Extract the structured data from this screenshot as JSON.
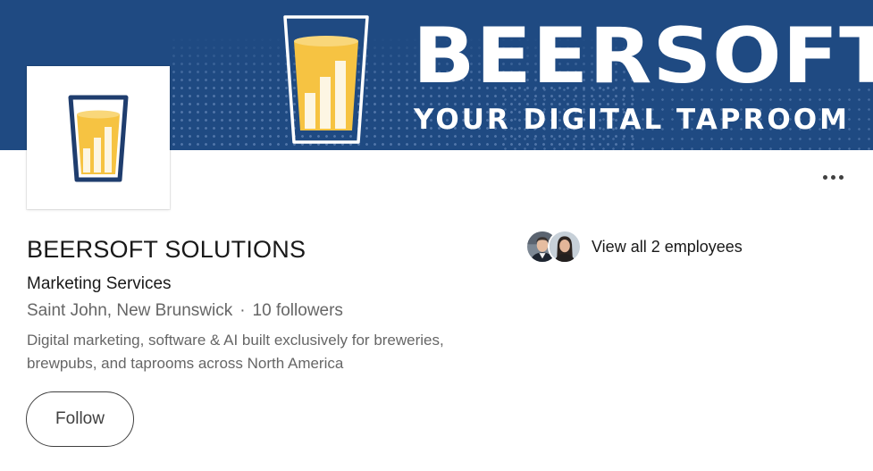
{
  "banner": {
    "title": "BEERSOFT",
    "tagline": "YOUR DIGITAL TAPROOM"
  },
  "company": {
    "name": "BEERSOFT SOLUTIONS",
    "industry": "Marketing Services",
    "location": "Saint John, New Brunswick",
    "separator": "·",
    "followers": "10 followers",
    "tagline": "Digital marketing, software & AI built exclusively for breweries, brewpubs, and taprooms across North America"
  },
  "employees": {
    "link_label": "View all 2 employees"
  },
  "actions": {
    "follow_label": "Follow"
  },
  "icons": {
    "more": "more-horizontal-icon",
    "logo": "beer-glass-chart-icon"
  },
  "colors": {
    "banner_bg": "#1f4a82",
    "logo_navy": "#1f3d6e",
    "beer_yellow": "#f6c342",
    "text_primary": "#191919",
    "text_secondary": "#666666"
  }
}
